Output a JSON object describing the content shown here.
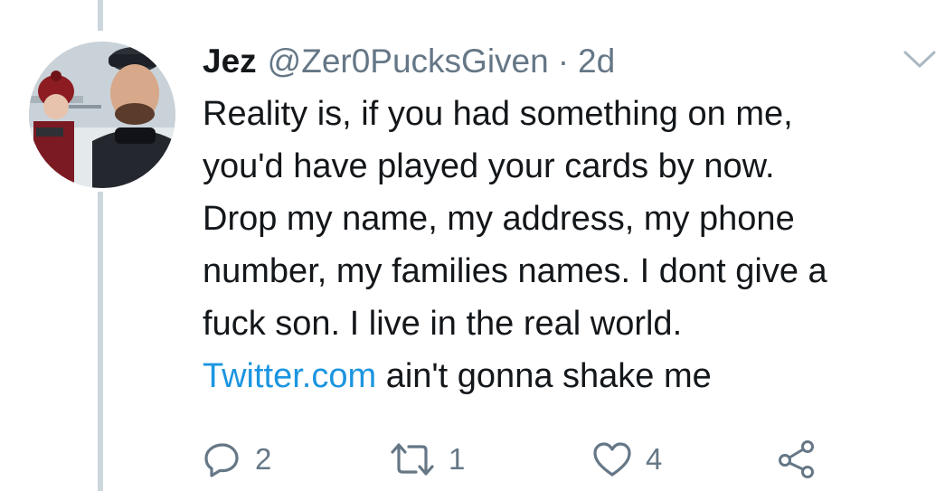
{
  "tweet": {
    "author": {
      "display_name": "Jez",
      "handle": "@Zer0PucksGiven",
      "separator": "·",
      "timestamp": "2d"
    },
    "text_lines": [
      "Reality is, if you had something on me,",
      "you'd have played your cards by now.",
      "Drop my name, my address, my phone",
      "number, my families names. I dont give a",
      "fuck son. I live in the real world."
    ],
    "last_line": {
      "link": "Twitter.com",
      "rest": " ain't gonna shake me"
    },
    "actions": {
      "reply": {
        "icon": "reply-icon",
        "count": "2"
      },
      "retweet": {
        "icon": "retweet-icon",
        "count": "1"
      },
      "like": {
        "icon": "heart-icon",
        "count": "4"
      },
      "share": {
        "icon": "share-icon"
      }
    }
  },
  "colors": {
    "text": "#14171a",
    "secondary": "#657786",
    "link": "#1b95e0",
    "thread_line": "#ccd6dd"
  }
}
